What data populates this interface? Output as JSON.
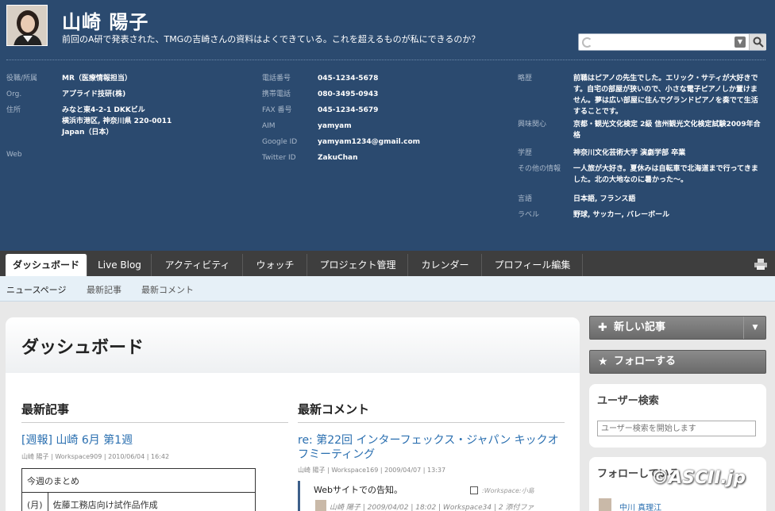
{
  "header": {
    "user_name": "山崎 陽子",
    "status_message": "前回のA研で発表された、TMGの吉崎さんの資料はよくできている。これを超えるものが私にできるのか？"
  },
  "profile": {
    "col1": [
      {
        "label": "役職/所属",
        "value": "MR（医療情報担当）"
      },
      {
        "label": "Org.",
        "value": "アプライド技研(株)"
      },
      {
        "label": "住所",
        "value": "みなと東4-2-1 DKKビル\n横浜市港区, 神奈川県 220-0011\nJapan（日本）"
      },
      {
        "label": "Web",
        "value": ""
      }
    ],
    "col2": [
      {
        "label": "電話番号",
        "value": "045-1234-5678"
      },
      {
        "label": "携帯電話",
        "value": "080-3495-0943"
      },
      {
        "label": "FAX 番号",
        "value": "045-1234-5679"
      },
      {
        "label": "AIM",
        "value": "yamyam"
      },
      {
        "label": "Google ID",
        "value": "yamyam1234@gmail.com"
      },
      {
        "label": "Twitter ID",
        "value": "ZakuChan"
      }
    ],
    "col3": [
      {
        "label": "略歴",
        "value": "前職はピアノの先生でした。エリック・サティが大好きです。自宅の部屋が狭いので、小さな電子ピアノしか置けません。夢は広い部屋に住んでグランドピアノを奏でて生活することです。"
      },
      {
        "label": "興味関心",
        "value": "京都・観光文化検定 2級 信州観光文化検定試験2009年合格"
      },
      {
        "label": "学歴",
        "value": "神奈川文化芸術大学 演劇学部 卒業"
      },
      {
        "label": "その他の情報",
        "value": "一人旅が大好き。夏休みは自転車で北海道まで行ってきました。北の大地なのに暑かった～。"
      },
      {
        "label": "言語",
        "value": "日本語, フランス語"
      },
      {
        "label": "ラベル",
        "value": "野球, サッカー, バレーボール"
      }
    ]
  },
  "tabs": [
    {
      "label": "ダッシュボード",
      "active": true
    },
    {
      "label": "Live Blog"
    },
    {
      "label": "アクティビティ"
    },
    {
      "label": "ウォッチ"
    },
    {
      "label": "プロジェクト管理"
    },
    {
      "label": "カレンダー"
    },
    {
      "label": "プロフィール編集"
    }
  ],
  "subnav": [
    "ニュースページ",
    "最新記事",
    "最新コメント"
  ],
  "main": {
    "title": "ダッシュボード",
    "latest_posts": {
      "heading": "最新記事",
      "post_title": "[週報] 山崎 6月 第1週",
      "post_meta": "山崎 陽子 | Workspace909 | 2010/06/04 | 16:42",
      "table": [
        [
          "今週のまとめ"
        ],
        [
          "(月)",
          "佐藤工務店向け試作品作成"
        ]
      ]
    },
    "latest_comments": {
      "heading": "最新コメント",
      "comment_title": "re: 第22回 インターフェックス・ジャパン キックオフミーティング",
      "comment_meta": "山崎 陽子 | Workspace169 | 2009/04/07 | 13:37",
      "quote_text": "Webサイトでの告知。",
      "quote_workspace": ":Workspace:小島",
      "quote_meta": "山崎 陽子 | 2009/04/02 | 18:02 | Workspace34 | 2 添付ファ"
    }
  },
  "sidebar": {
    "new_post_label": "新しい記事",
    "follow_label": "フォローする",
    "user_search_title": "ユーザー検索",
    "user_search_placeholder": "ユーザー検索を開始します",
    "following_title": "フォローしている",
    "following_user": "中川 真理江"
  },
  "watermark": "©ASCII.jp"
}
